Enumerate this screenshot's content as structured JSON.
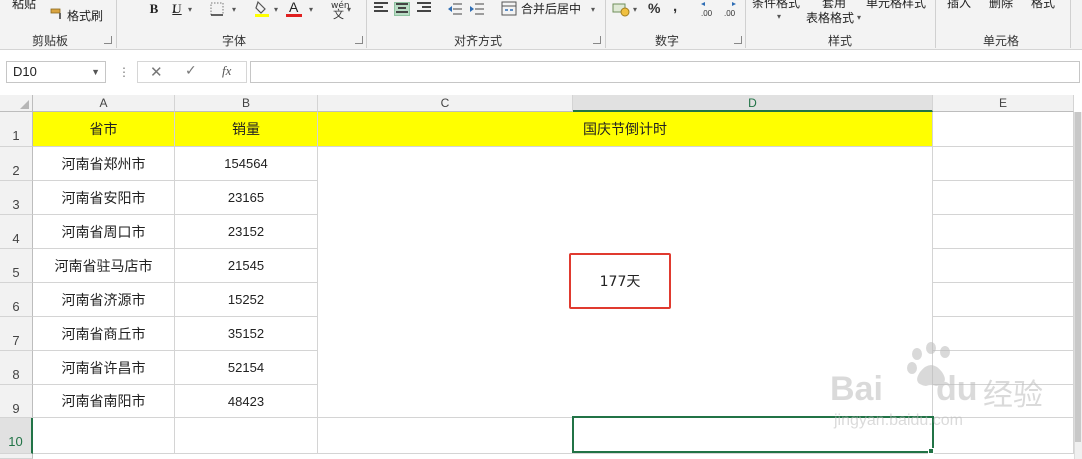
{
  "ribbon": {
    "clipboard": {
      "paste_label": "粘贴",
      "format_painter_label": "格式刷",
      "group_label": "剪贴板"
    },
    "font": {
      "bold": "B",
      "italic": "I",
      "underline": "U",
      "font_color_letter": "A",
      "phonetic_top": "wén",
      "phonetic_bottom": "文",
      "group_label": "字体"
    },
    "alignment": {
      "merge_center_label": "合并后居中",
      "group_label": "对齐方式"
    },
    "number": {
      "percent": "%",
      "comma": ",",
      "inc_decimal": ".00",
      "dec_decimal": ".00",
      "group_label": "数字"
    },
    "styles": {
      "conditional_format": "条件格式",
      "table_format_1": "套用",
      "table_format_2": "表格格式",
      "cell_styles": "单元格样式",
      "group_label": "样式"
    },
    "cells": {
      "insert": "插入",
      "delete": "删除",
      "format": "格式",
      "group_label": "单元格"
    }
  },
  "formula_bar": {
    "name_box": "D10",
    "fx": "fx",
    "content": ""
  },
  "columns": [
    "A",
    "B",
    "C",
    "D",
    "E"
  ],
  "selected_column": "D",
  "rows": [
    "1",
    "2",
    "3",
    "4",
    "5",
    "6",
    "7",
    "8",
    "9",
    "10"
  ],
  "selected_row": "10",
  "headers": {
    "province_city": "省市",
    "sales": "销量",
    "countdown_title": "国庆节倒计时"
  },
  "table": [
    {
      "city": "河南省郑州市",
      "sales": "154564"
    },
    {
      "city": "河南省安阳市",
      "sales": "23165"
    },
    {
      "city": "河南省周口市",
      "sales": "23152"
    },
    {
      "city": "河南省驻马店市",
      "sales": "21545"
    },
    {
      "city": "河南省济源市",
      "sales": "15252"
    },
    {
      "city": "河南省商丘市",
      "sales": "35152"
    },
    {
      "city": "河南省许昌市",
      "sales": "52154"
    },
    {
      "city": "河南省南阳市",
      "sales": "48423"
    }
  ],
  "countdown_value": "177天",
  "watermark": {
    "brand": "Bai",
    "brand_mid": "du",
    "brand_cn": "经验",
    "url": "jingyan.baidu.com"
  },
  "colors": {
    "header_fill": "#ffff00",
    "selection": "#217346",
    "highlight_box": "#e03a2f"
  }
}
